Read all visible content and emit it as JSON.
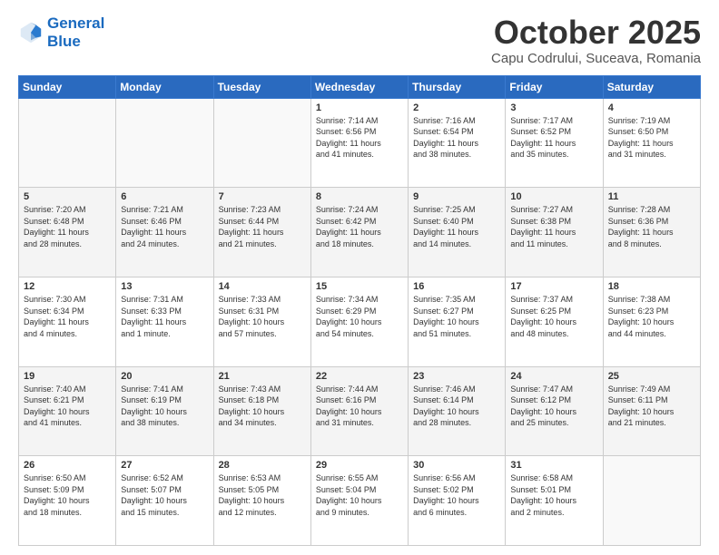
{
  "header": {
    "logo_line1": "General",
    "logo_line2": "Blue",
    "month": "October 2025",
    "location": "Capu Codrului, Suceava, Romania"
  },
  "weekdays": [
    "Sunday",
    "Monday",
    "Tuesday",
    "Wednesday",
    "Thursday",
    "Friday",
    "Saturday"
  ],
  "weeks": [
    [
      {
        "day": "",
        "info": ""
      },
      {
        "day": "",
        "info": ""
      },
      {
        "day": "",
        "info": ""
      },
      {
        "day": "1",
        "info": "Sunrise: 7:14 AM\nSunset: 6:56 PM\nDaylight: 11 hours\nand 41 minutes."
      },
      {
        "day": "2",
        "info": "Sunrise: 7:16 AM\nSunset: 6:54 PM\nDaylight: 11 hours\nand 38 minutes."
      },
      {
        "day": "3",
        "info": "Sunrise: 7:17 AM\nSunset: 6:52 PM\nDaylight: 11 hours\nand 35 minutes."
      },
      {
        "day": "4",
        "info": "Sunrise: 7:19 AM\nSunset: 6:50 PM\nDaylight: 11 hours\nand 31 minutes."
      }
    ],
    [
      {
        "day": "5",
        "info": "Sunrise: 7:20 AM\nSunset: 6:48 PM\nDaylight: 11 hours\nand 28 minutes."
      },
      {
        "day": "6",
        "info": "Sunrise: 7:21 AM\nSunset: 6:46 PM\nDaylight: 11 hours\nand 24 minutes."
      },
      {
        "day": "7",
        "info": "Sunrise: 7:23 AM\nSunset: 6:44 PM\nDaylight: 11 hours\nand 21 minutes."
      },
      {
        "day": "8",
        "info": "Sunrise: 7:24 AM\nSunset: 6:42 PM\nDaylight: 11 hours\nand 18 minutes."
      },
      {
        "day": "9",
        "info": "Sunrise: 7:25 AM\nSunset: 6:40 PM\nDaylight: 11 hours\nand 14 minutes."
      },
      {
        "day": "10",
        "info": "Sunrise: 7:27 AM\nSunset: 6:38 PM\nDaylight: 11 hours\nand 11 minutes."
      },
      {
        "day": "11",
        "info": "Sunrise: 7:28 AM\nSunset: 6:36 PM\nDaylight: 11 hours\nand 8 minutes."
      }
    ],
    [
      {
        "day": "12",
        "info": "Sunrise: 7:30 AM\nSunset: 6:34 PM\nDaylight: 11 hours\nand 4 minutes."
      },
      {
        "day": "13",
        "info": "Sunrise: 7:31 AM\nSunset: 6:33 PM\nDaylight: 11 hours\nand 1 minute."
      },
      {
        "day": "14",
        "info": "Sunrise: 7:33 AM\nSunset: 6:31 PM\nDaylight: 10 hours\nand 57 minutes."
      },
      {
        "day": "15",
        "info": "Sunrise: 7:34 AM\nSunset: 6:29 PM\nDaylight: 10 hours\nand 54 minutes."
      },
      {
        "day": "16",
        "info": "Sunrise: 7:35 AM\nSunset: 6:27 PM\nDaylight: 10 hours\nand 51 minutes."
      },
      {
        "day": "17",
        "info": "Sunrise: 7:37 AM\nSunset: 6:25 PM\nDaylight: 10 hours\nand 48 minutes."
      },
      {
        "day": "18",
        "info": "Sunrise: 7:38 AM\nSunset: 6:23 PM\nDaylight: 10 hours\nand 44 minutes."
      }
    ],
    [
      {
        "day": "19",
        "info": "Sunrise: 7:40 AM\nSunset: 6:21 PM\nDaylight: 10 hours\nand 41 minutes."
      },
      {
        "day": "20",
        "info": "Sunrise: 7:41 AM\nSunset: 6:19 PM\nDaylight: 10 hours\nand 38 minutes."
      },
      {
        "day": "21",
        "info": "Sunrise: 7:43 AM\nSunset: 6:18 PM\nDaylight: 10 hours\nand 34 minutes."
      },
      {
        "day": "22",
        "info": "Sunrise: 7:44 AM\nSunset: 6:16 PM\nDaylight: 10 hours\nand 31 minutes."
      },
      {
        "day": "23",
        "info": "Sunrise: 7:46 AM\nSunset: 6:14 PM\nDaylight: 10 hours\nand 28 minutes."
      },
      {
        "day": "24",
        "info": "Sunrise: 7:47 AM\nSunset: 6:12 PM\nDaylight: 10 hours\nand 25 minutes."
      },
      {
        "day": "25",
        "info": "Sunrise: 7:49 AM\nSunset: 6:11 PM\nDaylight: 10 hours\nand 21 minutes."
      }
    ],
    [
      {
        "day": "26",
        "info": "Sunrise: 6:50 AM\nSunset: 5:09 PM\nDaylight: 10 hours\nand 18 minutes."
      },
      {
        "day": "27",
        "info": "Sunrise: 6:52 AM\nSunset: 5:07 PM\nDaylight: 10 hours\nand 15 minutes."
      },
      {
        "day": "28",
        "info": "Sunrise: 6:53 AM\nSunset: 5:05 PM\nDaylight: 10 hours\nand 12 minutes."
      },
      {
        "day": "29",
        "info": "Sunrise: 6:55 AM\nSunset: 5:04 PM\nDaylight: 10 hours\nand 9 minutes."
      },
      {
        "day": "30",
        "info": "Sunrise: 6:56 AM\nSunset: 5:02 PM\nDaylight: 10 hours\nand 6 minutes."
      },
      {
        "day": "31",
        "info": "Sunrise: 6:58 AM\nSunset: 5:01 PM\nDaylight: 10 hours\nand 2 minutes."
      },
      {
        "day": "",
        "info": ""
      }
    ]
  ]
}
